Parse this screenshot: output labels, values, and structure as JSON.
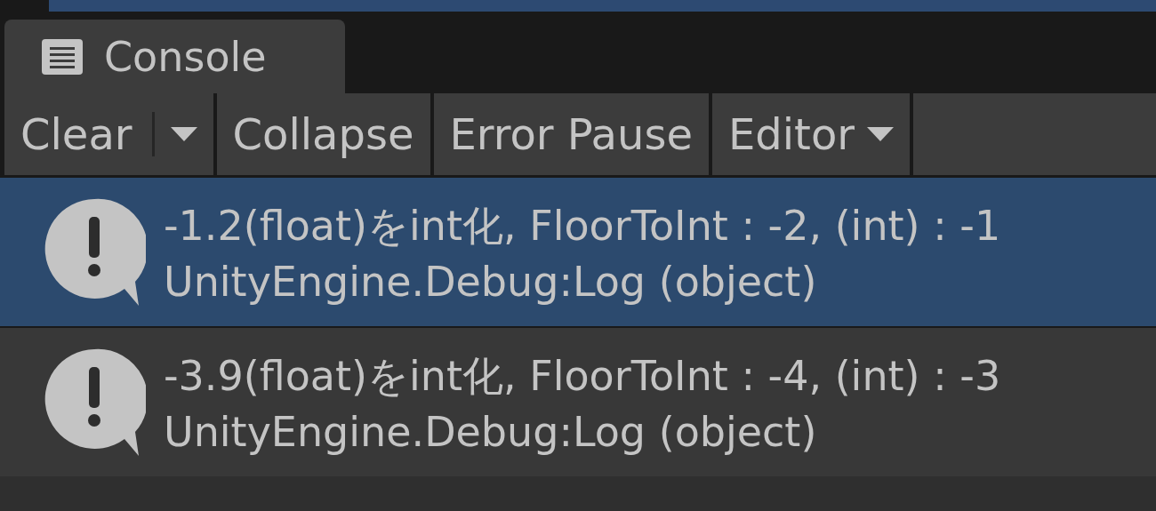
{
  "tab": {
    "label": "Console",
    "selected": true
  },
  "toolbar": [
    {
      "label": "Clear",
      "kind": "split"
    },
    {
      "label": "Collapse",
      "kind": "toggle"
    },
    {
      "label": "Error Pause",
      "kind": "toggle"
    },
    {
      "label": "Editor",
      "kind": "dropdown"
    }
  ],
  "entries": [
    {
      "message": "-1.2(float)をint化, FloorToInt : -2, (int) : -1",
      "trace": "UnityEngine.Debug:Log (object)",
      "selected": true
    },
    {
      "message": "-3.9(float)をint化, FloorToInt : -4, (int) : -3",
      "trace": "UnityEngine.Debug:Log (object)",
      "selected": false
    }
  ]
}
